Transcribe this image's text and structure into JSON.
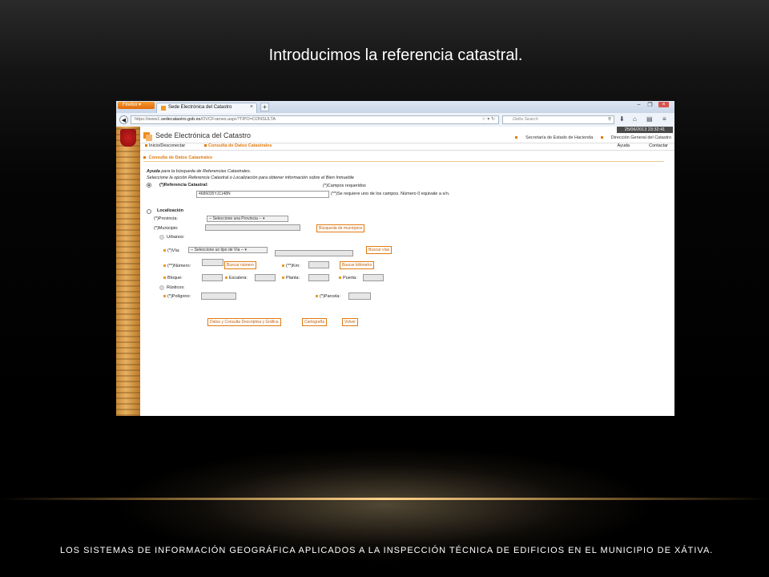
{
  "slide": {
    "title": "Introducimos la referencia catastral.",
    "footer": "LOS SISTEMAS DE INFORMACIÓN GEOGRÁFICA APLICADOS A LA INSPECCIÓN TÉCNICA DE EDIFICIOS EN EL MUNICIPIO DE XÁTIVA."
  },
  "browser": {
    "menu_button": "Firefox",
    "tab_title": "Sede Electrónica del Catastro",
    "url_prefix": "https://www1.",
    "url_domain": "sedecatastro.gob.es",
    "url_path": "/OVCFrames.aspx?TIPO=CONSULTA",
    "search_placeholder": "Delta Search"
  },
  "site": {
    "date": "25/06/2013 23:32:41",
    "name": "Sede Electrónica del Catastro",
    "header_link1": "Secretaría de Estado de Hacienda",
    "header_link2": "Dirección General del Catastro",
    "menu_home": "Inicio/Desconectar",
    "menu_current": "Consulta de Datos Catastrales",
    "menu_help": "Ayuda",
    "menu_contact": "Contactar"
  },
  "form": {
    "section_title": "Consulta de Datos Catastrales",
    "help_bold": "Ayuda",
    "help_text": " para la búsqueda de Referencias Catastrales.",
    "instructions": "Seleccione la opción Referencia Catastral o Localización para obtener información sobre el Bien Inmueble",
    "ref_label": "(*)Referencia Catastral:",
    "ref_value": "4686035YJ1148N",
    "required_note": "(*)Campos requeridos",
    "either_note": "(**)Se requiere uno de los campos. Número 0 equivale a s/n.",
    "loc_label": "Localización",
    "provincia_label": "(*)Provincia:",
    "provincia_select": "-- Seleccione una Provincia --",
    "municipio_label": "(*)Municipio:",
    "municipio_button": "Búsqueda de municipios",
    "urbanos_label": "Urbanos:",
    "via_label": "(*)Vía:",
    "via_select": "-- Seleccione un tipo de Vía --",
    "via_button": "Buscar vías",
    "numero_label": "(**)Número:",
    "numero_button": "Buscar número",
    "km_label": "(**)Km:",
    "km_button": "Buscar kilómetro",
    "bloque_label": "Bloque:",
    "escalera_label": "Escalera:",
    "planta_label": "Planta:",
    "puerta_label": "Puerta:",
    "rusticos_label": "Rústicos:",
    "poligono_label": "(*)Polígono:",
    "parcela_label": "(*)Parcela:",
    "btn_datos": "Datos y Consulta Descriptiva y Gráfica",
    "btn_cartografia": "Cartografía",
    "btn_volver": "Volver"
  }
}
